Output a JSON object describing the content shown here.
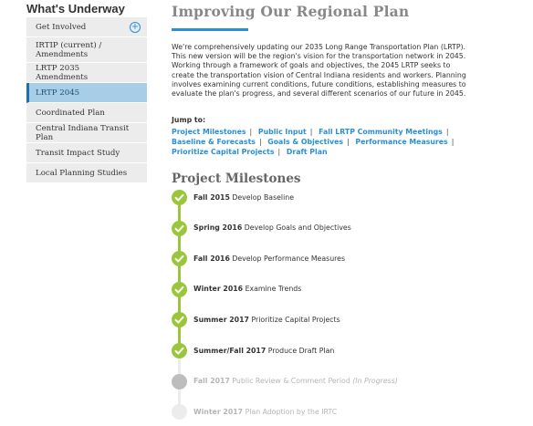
{
  "sidebar": {
    "title": "What's Underway",
    "items": [
      {
        "label": "Get Involved"
      },
      {
        "label": "IRTIP (current) / Amendments"
      },
      {
        "label": "LRTP 2035 Amendments"
      },
      {
        "label": "LRTP 2045"
      },
      {
        "label": "Coordinated Plan"
      },
      {
        "label": "Central Indiana Transit Plan"
      },
      {
        "label": "Transit Impact Study"
      },
      {
        "label": "Local Planning Studies"
      }
    ]
  },
  "main": {
    "title": "Improving Our Regional Plan",
    "intro": "We're comprehensively updating our 2035 Long Range Transportation Plan (LRTP). This new version will be the region's vision for the transportation network in 2045. Working through a framework of goals and objectives, the 2045 LRTP seeks to create the transportation vision of Central Indiana residents and workers. Planning involves examining current conditions, future conditions, establishing measures to evaluate the plan's progress, and several different scenarios of our future in 2045.",
    "jump_label": "Jump to:",
    "jump_links": [
      "Project Milestones",
      "Public Input",
      "Fall LRTP Community Meetings",
      "Baseline & Forecasts",
      "Goals & Objectives",
      "Performance Measures",
      "Prioritize Capital Projects",
      "Draft Plan"
    ],
    "milestones_title": "Project Milestones",
    "milestones": [
      {
        "period": "Fall 2015",
        "task": "Develop Baseline",
        "status_text": "",
        "state": "done"
      },
      {
        "period": "Spring 2016",
        "task": "Develop Goals and Objectives",
        "status_text": "",
        "state": "done"
      },
      {
        "period": "Fall 2016",
        "task": "Develop Performance Measures",
        "status_text": "",
        "state": "done"
      },
      {
        "period": "Winter 2016",
        "task": "Examine Trends",
        "status_text": "",
        "state": "done"
      },
      {
        "period": "Summer 2017",
        "task": "Prioritize Capital Projects",
        "status_text": "",
        "state": "done"
      },
      {
        "period": "Summer/Fall 2017",
        "task": "Produce Draft Plan",
        "status_text": "",
        "state": "done"
      },
      {
        "period": "Fall 2017",
        "task": "Public Review & Comment Period",
        "status_text": "(In Progress)",
        "state": "current"
      },
      {
        "period": "Winter 2017",
        "task": "Plan Adoption by the IRTC",
        "status_text": "",
        "state": "future"
      }
    ]
  },
  "colors": {
    "accent_blue": "#2a8fd6",
    "done_green": "#9ac63c",
    "active_bg": "#a8cde6",
    "current_gray": "#bdbdbd",
    "future_gray": "#ececec"
  }
}
